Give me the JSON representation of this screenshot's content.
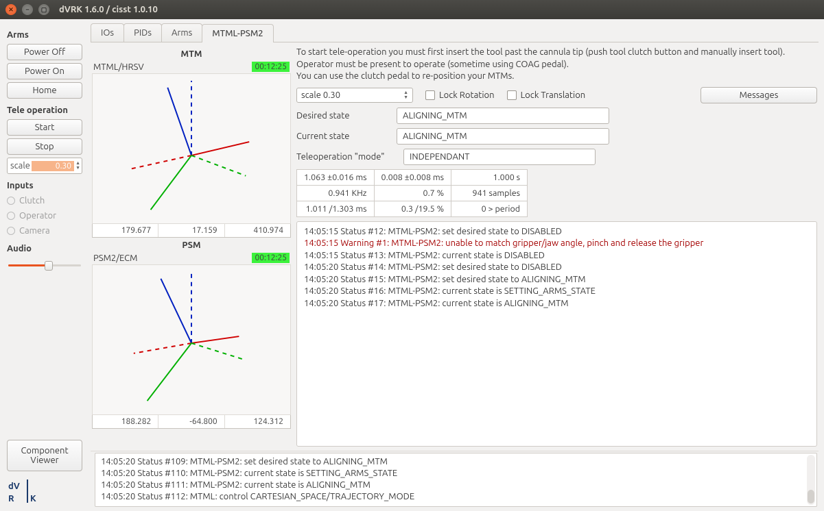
{
  "window": {
    "title": "dVRK 1.6.0 / cisst 1.0.10"
  },
  "sidebar": {
    "arms_label": "Arms",
    "power_off": "Power Off",
    "power_on": "Power On",
    "home": "Home",
    "teleop_label": "Tele operation",
    "start": "Start",
    "stop": "Stop",
    "scale_prefix": "scale",
    "scale_value": "0.30",
    "inputs_label": "Inputs",
    "clutch": "Clutch",
    "operator": "Operator",
    "camera": "Camera",
    "audio_label": "Audio",
    "component_viewer": "Component\nViewer"
  },
  "tabs": [
    "IOs",
    "PIDs",
    "Arms",
    "MTML-PSM2"
  ],
  "active_tab": 3,
  "mtm": {
    "title": "MTM",
    "name": "MTML/HRSV",
    "time": "00:12:25",
    "v0": "179.677",
    "v1": "17.159",
    "v2": "410.974"
  },
  "psm": {
    "title": "PSM",
    "name": "PSM2/ECM",
    "time": "00:12:25",
    "v0": "188.282",
    "v1": "-64.800",
    "v2": "124.312"
  },
  "instructions": "To start tele-operation you must first insert the tool past the cannula tip (push tool clutch button and manually insert tool).\nOperator must be present to operate (sometime using COAG pedal).\nYou can use the clutch pedal to re-position your MTMs.",
  "controls": {
    "scale_value": "scale 0.30",
    "lock_rotation": "Lock Rotation",
    "lock_translation": "Lock Translation",
    "messages": "Messages",
    "desired_label": "Desired state",
    "desired_value": "ALIGNING_MTM",
    "current_label": "Current state",
    "current_value": "ALIGNING_MTM",
    "mode_label": "Teleoperation \"mode\"",
    "mode_value": "INDEPENDANT"
  },
  "stats": {
    "c0": [
      "1.063 ±0.016 ms",
      "0.941  KHz",
      "1.011 /1.303 ms"
    ],
    "c1": [
      "0.008 ±0.008 ms",
      "0.7  %",
      "0.3  /19.5 %"
    ],
    "c2": [
      "1.000 s",
      "941 samples",
      "0 > period"
    ]
  },
  "log": [
    {
      "t": "14:05:15 Status #12: MTML-PSM2: set desired state to DISABLED",
      "warn": false
    },
    {
      "t": "14:05:15 Warning #1: MTML-PSM2: unable to match gripper/jaw angle, pinch and release the gripper",
      "warn": true
    },
    {
      "t": "14:05:15 Status #13: MTML-PSM2: current state is DISABLED",
      "warn": false
    },
    {
      "t": "14:05:20 Status #14: MTML-PSM2: set desired state to DISABLED",
      "warn": false
    },
    {
      "t": "14:05:20 Status #15: MTML-PSM2: set desired state to ALIGNING_MTM",
      "warn": false
    },
    {
      "t": "14:05:20 Status #16: MTML-PSM2: current state is SETTING_ARMS_STATE",
      "warn": false
    },
    {
      "t": "14:05:20 Status #17: MTML-PSM2: current state is ALIGNING_MTM",
      "warn": false
    }
  ],
  "footer_log": [
    "14:05:20 Status #109: MTML-PSM2: set desired state to ALIGNING_MTM",
    "14:05:20 Status #110: MTML-PSM2: current state is SETTING_ARMS_STATE",
    "14:05:20 Status #111: MTML-PSM2: current state is ALIGNING_MTM",
    "14:05:20 Status #112: MTML: control CARTESIAN_SPACE/TRAJECTORY_MODE"
  ]
}
